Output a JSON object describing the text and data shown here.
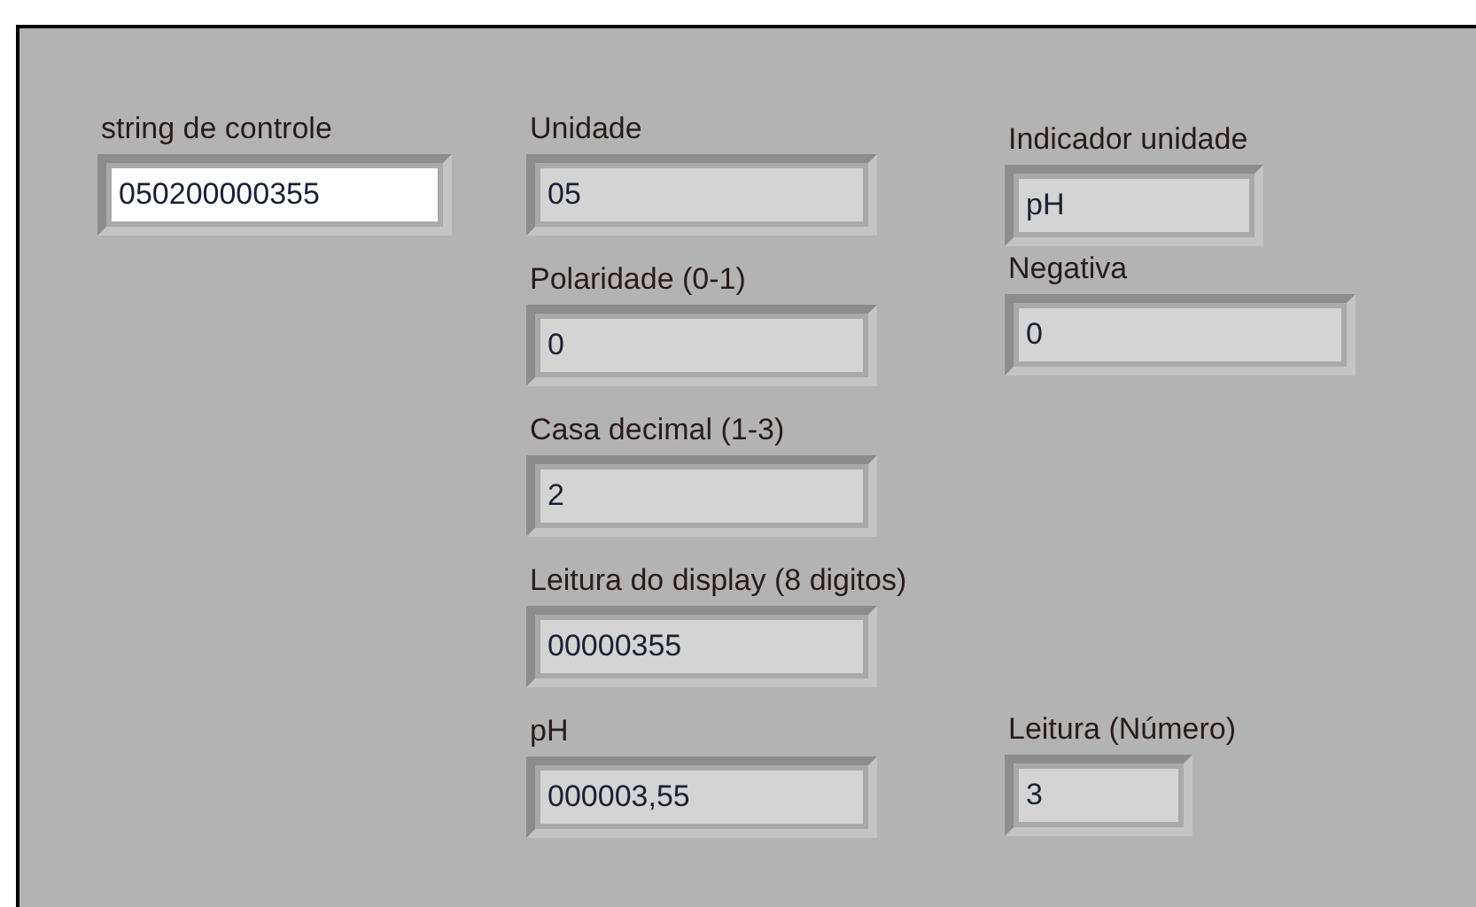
{
  "controls": [
    {
      "label": "string de controle",
      "value": "050200000355",
      "kind": "control"
    },
    {
      "label": "Unidade",
      "value": "05",
      "kind": "indicator"
    },
    {
      "label": "Indicador unidade",
      "value": "pH",
      "kind": "indicator"
    },
    {
      "label": "Polaridade (0-1)",
      "value": "0",
      "kind": "indicator"
    },
    {
      "label": "Negativa",
      "value": "0",
      "kind": "indicator"
    },
    {
      "label": "Casa decimal (1-3)",
      "value": "2",
      "kind": "indicator"
    },
    {
      "label": "Leitura do display (8 digitos)",
      "value": "00000355",
      "kind": "indicator"
    },
    {
      "label": "pH",
      "value": "000003,55",
      "kind": "indicator"
    },
    {
      "label": "Leitura (Número)",
      "value": "3",
      "kind": "indicator"
    }
  ]
}
